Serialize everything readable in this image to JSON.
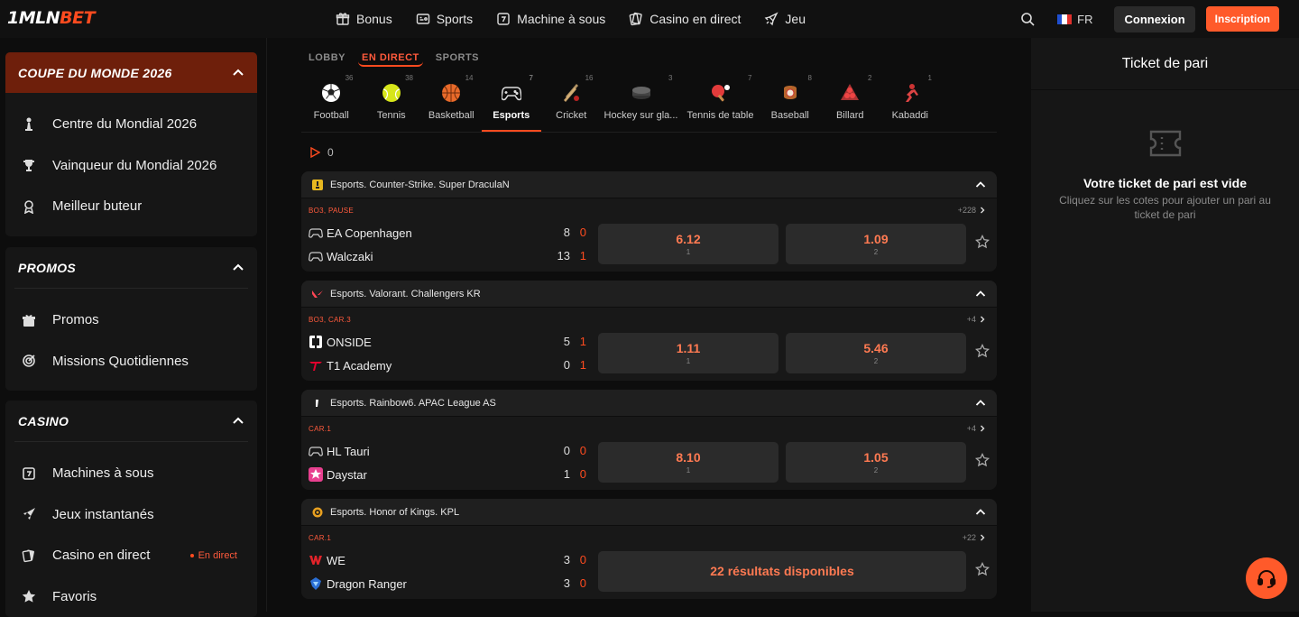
{
  "header": {
    "logo_main": "1MLN",
    "logo_accent": "BET",
    "nav": [
      {
        "label": "Bonus",
        "icon": "gift-icon"
      },
      {
        "label": "Sports",
        "icon": "ticket-icon"
      },
      {
        "label": "Machine à sous",
        "icon": "slot-icon"
      },
      {
        "label": "Casino en direct",
        "icon": "cards-icon"
      },
      {
        "label": "Jeu",
        "icon": "rocket-icon"
      }
    ],
    "lang": "FR",
    "login": "Connexion",
    "signup": "Inscription"
  },
  "sidebar": {
    "world_cup": {
      "title": "COUPE DU MONDE 2026",
      "items": [
        "Centre du Mondial 2026",
        "Vainqueur du Mondial 2026",
        "Meilleur buteur"
      ]
    },
    "promos": {
      "title": "PROMOS",
      "items": [
        "Promos",
        "Missions Quotidiennes"
      ]
    },
    "casino": {
      "title": "CASINO",
      "items": [
        "Machines à sous",
        "Jeux instantanés",
        "Casino en direct",
        "Favoris"
      ],
      "live_badge": "En direct"
    }
  },
  "main": {
    "tabs": [
      "LOBBY",
      "EN DIRECT",
      "SPORTS"
    ],
    "active_tab": "EN DIRECT",
    "sports": [
      {
        "label": "Football",
        "count": "36"
      },
      {
        "label": "Tennis",
        "count": "38"
      },
      {
        "label": "Basketball",
        "count": "14"
      },
      {
        "label": "Esports",
        "count": "7"
      },
      {
        "label": "Cricket",
        "count": "16"
      },
      {
        "label": "Hockey sur gla...",
        "count": "3"
      },
      {
        "label": "Tennis de table",
        "count": "7"
      },
      {
        "label": "Baseball",
        "count": "8"
      },
      {
        "label": "Billard",
        "count": "2"
      },
      {
        "label": "Kabaddi",
        "count": "1"
      }
    ],
    "live_count": "0",
    "leagues": [
      {
        "title": "Esports. Counter-Strike. Super DraculaN",
        "phase": "BO3, PAUSE",
        "more": "+228",
        "teams": [
          {
            "name": "EA Copenhagen",
            "score": "8",
            "sets": "0"
          },
          {
            "name": "Walczaki",
            "score": "13",
            "sets": "1"
          }
        ],
        "odds": [
          {
            "value": "6.12",
            "key": "1"
          },
          {
            "value": "1.09",
            "key": "2"
          }
        ]
      },
      {
        "title": "Esports. Valorant. Challengers KR",
        "phase": "BO3, CAR.3",
        "more": "+4",
        "teams": [
          {
            "name": "ONSIDE",
            "score": "5",
            "sets": "1"
          },
          {
            "name": "T1 Academy",
            "score": "0",
            "sets": "1"
          }
        ],
        "odds": [
          {
            "value": "1.11",
            "key": "1"
          },
          {
            "value": "5.46",
            "key": "2"
          }
        ]
      },
      {
        "title": "Esports. Rainbow6. APAC League AS",
        "phase": "CAR.1",
        "more": "+4",
        "teams": [
          {
            "name": "HL Tauri",
            "score": "0",
            "sets": "0"
          },
          {
            "name": "Daystar",
            "score": "1",
            "sets": "0"
          }
        ],
        "odds": [
          {
            "value": "8.10",
            "key": "1"
          },
          {
            "value": "1.05",
            "key": "2"
          }
        ]
      },
      {
        "title": "Esports. Honor of Kings. KPL",
        "phase": "CAR.1",
        "more": "+22",
        "teams": [
          {
            "name": "WE",
            "score": "3",
            "sets": "0"
          },
          {
            "name": "Dragon Ranger",
            "score": "3",
            "sets": "0"
          }
        ],
        "results_label": "22 résultats disponibles"
      }
    ]
  },
  "ticket": {
    "title": "Ticket de pari",
    "empty_title": "Votre ticket de pari est vide",
    "empty_text": "Cliquez sur les cotes pour ajouter un pari au ticket de pari"
  },
  "colors": {
    "accent": "#ff4b1f",
    "odd_text": "#ff7a52",
    "panel": "#161616"
  }
}
